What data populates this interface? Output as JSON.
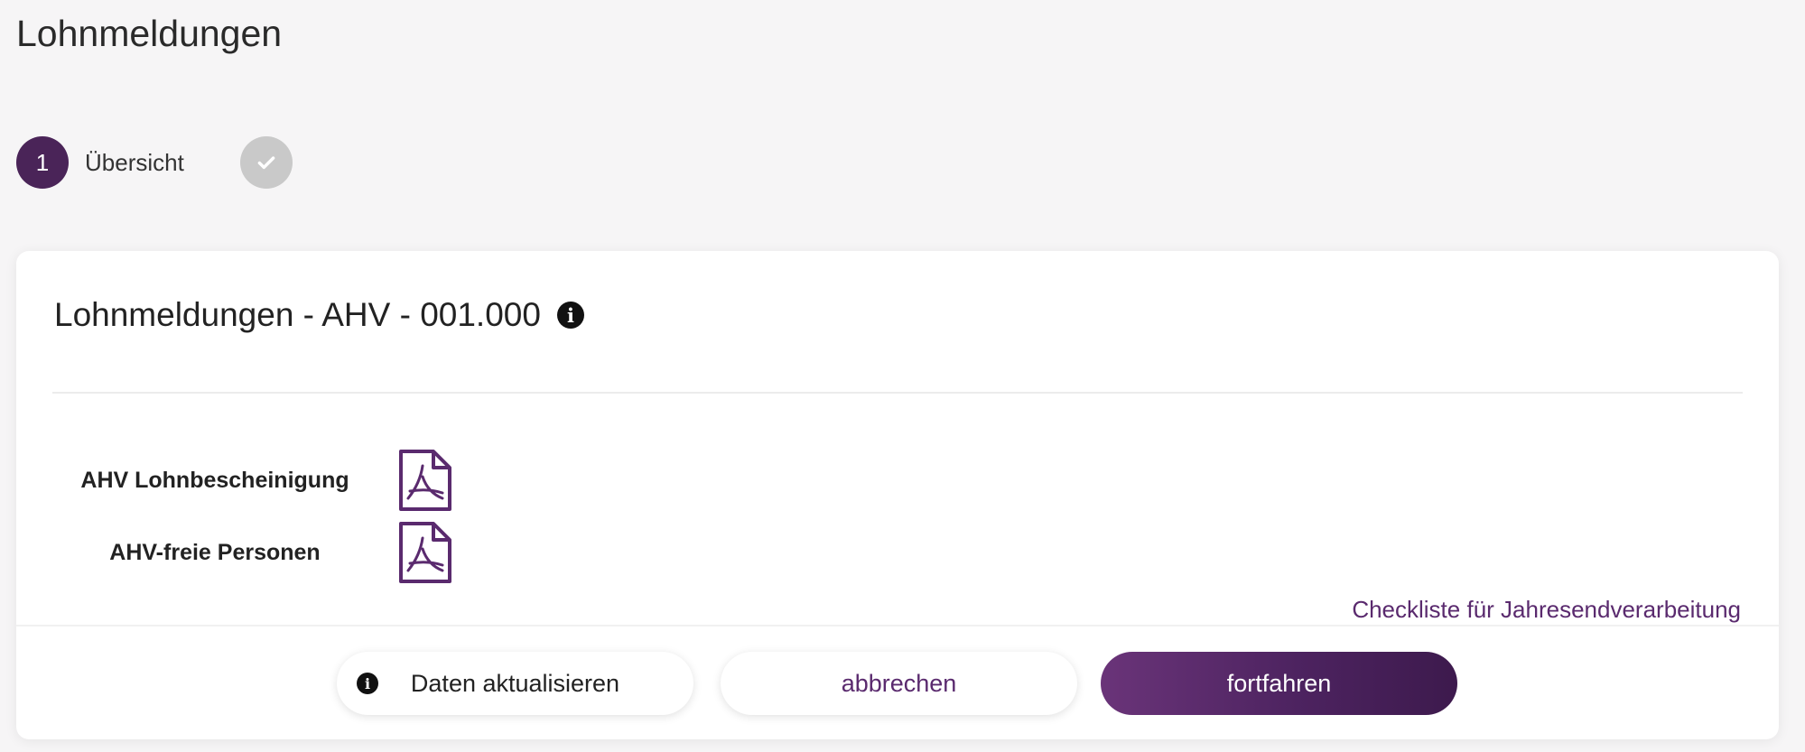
{
  "page": {
    "title": "Lohnmeldungen"
  },
  "stepper": {
    "steps": [
      {
        "number": "1",
        "label": "Übersicht",
        "state": "active"
      },
      {
        "number": "",
        "label": "",
        "state": "done",
        "icon": "check-icon"
      }
    ]
  },
  "card": {
    "title": "Lohnmeldungen - AHV - 001.000",
    "title_icon": "info-icon",
    "documents": [
      {
        "label": "AHV Lohnbescheinigung",
        "icon": "pdf-icon"
      },
      {
        "label": "AHV-freie Personen",
        "icon": "pdf-icon"
      }
    ],
    "checklist_link": "Checkliste für Jahresendverarbeitung"
  },
  "actions": {
    "refresh_label": "Daten aktualisieren",
    "cancel_label": "abbrechen",
    "continue_label": "fortfahren"
  },
  "colors": {
    "accent": "#4a2458",
    "link": "#5a2a6e",
    "step_done": "#c9c9c9"
  }
}
